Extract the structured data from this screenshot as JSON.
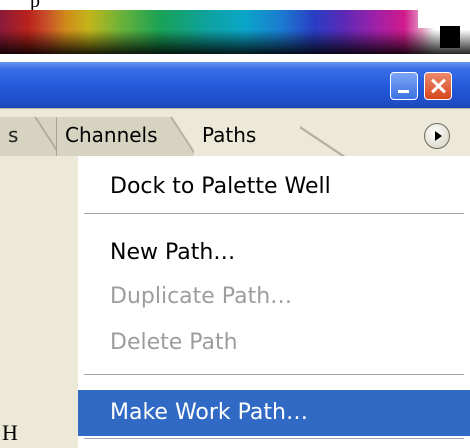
{
  "window": {
    "minimize": "minimize",
    "close": "close"
  },
  "tabs": [
    {
      "label": "s"
    },
    {
      "label": "Channels"
    },
    {
      "label": "Paths"
    }
  ],
  "menu": {
    "items": [
      {
        "label": "Dock to Palette Well",
        "enabled": true
      },
      {
        "label": "New Path…",
        "enabled": true
      },
      {
        "label": "Duplicate Path…",
        "enabled": false
      },
      {
        "label": "Delete Path",
        "enabled": false
      },
      {
        "label": "Make Work Path…",
        "enabled": true,
        "highlighted": true
      }
    ]
  },
  "fragments": {
    "top": "p",
    "body": "H"
  },
  "colors": {
    "titlebar": "#2358d8",
    "highlight": "#316ac5",
    "panel": "#ece9d8",
    "disabled": "#9d9d9d"
  }
}
